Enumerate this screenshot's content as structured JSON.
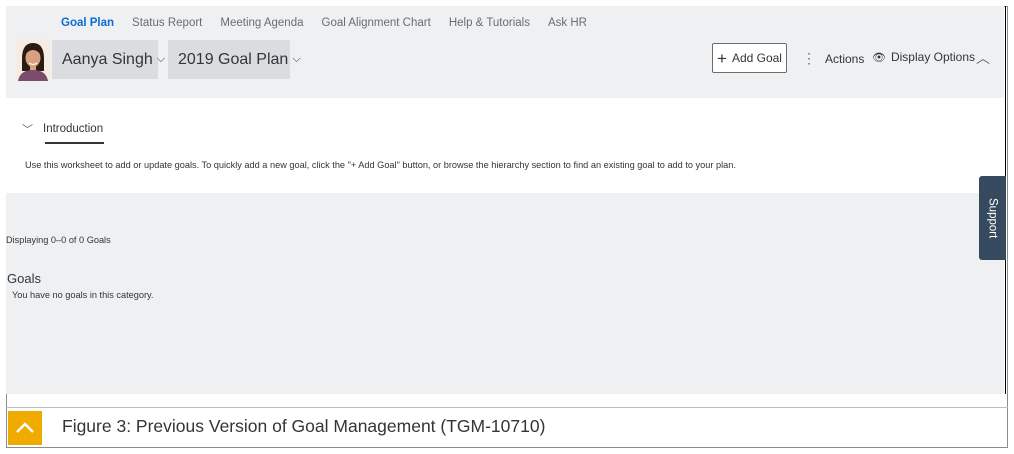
{
  "nav": {
    "items": [
      {
        "label": "Goal Plan",
        "active": true
      },
      {
        "label": "Status Report",
        "active": false
      },
      {
        "label": "Meeting Agenda",
        "active": false
      },
      {
        "label": "Goal Alignment Chart",
        "active": false
      },
      {
        "label": "Help & Tutorials",
        "active": false
      },
      {
        "label": "Ask HR",
        "active": false
      }
    ]
  },
  "header": {
    "user_name": "Aanya Singh",
    "plan_name": "2019 Goal Plan",
    "add_goal_label": "Add Goal",
    "actions_label": "Actions",
    "display_options_label": "Display Options",
    "icons": {
      "add": "plus-icon",
      "actions": "vertical-dots-icon",
      "display": "eye-icon",
      "collapse": "chevron-up-icon",
      "dropdown": "chevron-down-icon"
    }
  },
  "intro": {
    "tab_label": "Introduction",
    "text": "Use this worksheet to add or update goals. To quickly add a new goal, click the \"+ Add Goal\" button, or browse the hierarchy section to find an existing goal to add to your plan."
  },
  "goals": {
    "displaying": "Displaying 0–0 of 0 Goals",
    "title": "Goals",
    "empty_message": "You have no goals in this category."
  },
  "support": {
    "label": "Support"
  },
  "caption": {
    "text": "Figure 3: Previous Version of Goal Management (TGM-10710)"
  },
  "colors": {
    "accent": "#0a6ed1",
    "background": "#eff0f1",
    "support_tab": "#354a5f",
    "caption_icon": "#f0ab00"
  }
}
